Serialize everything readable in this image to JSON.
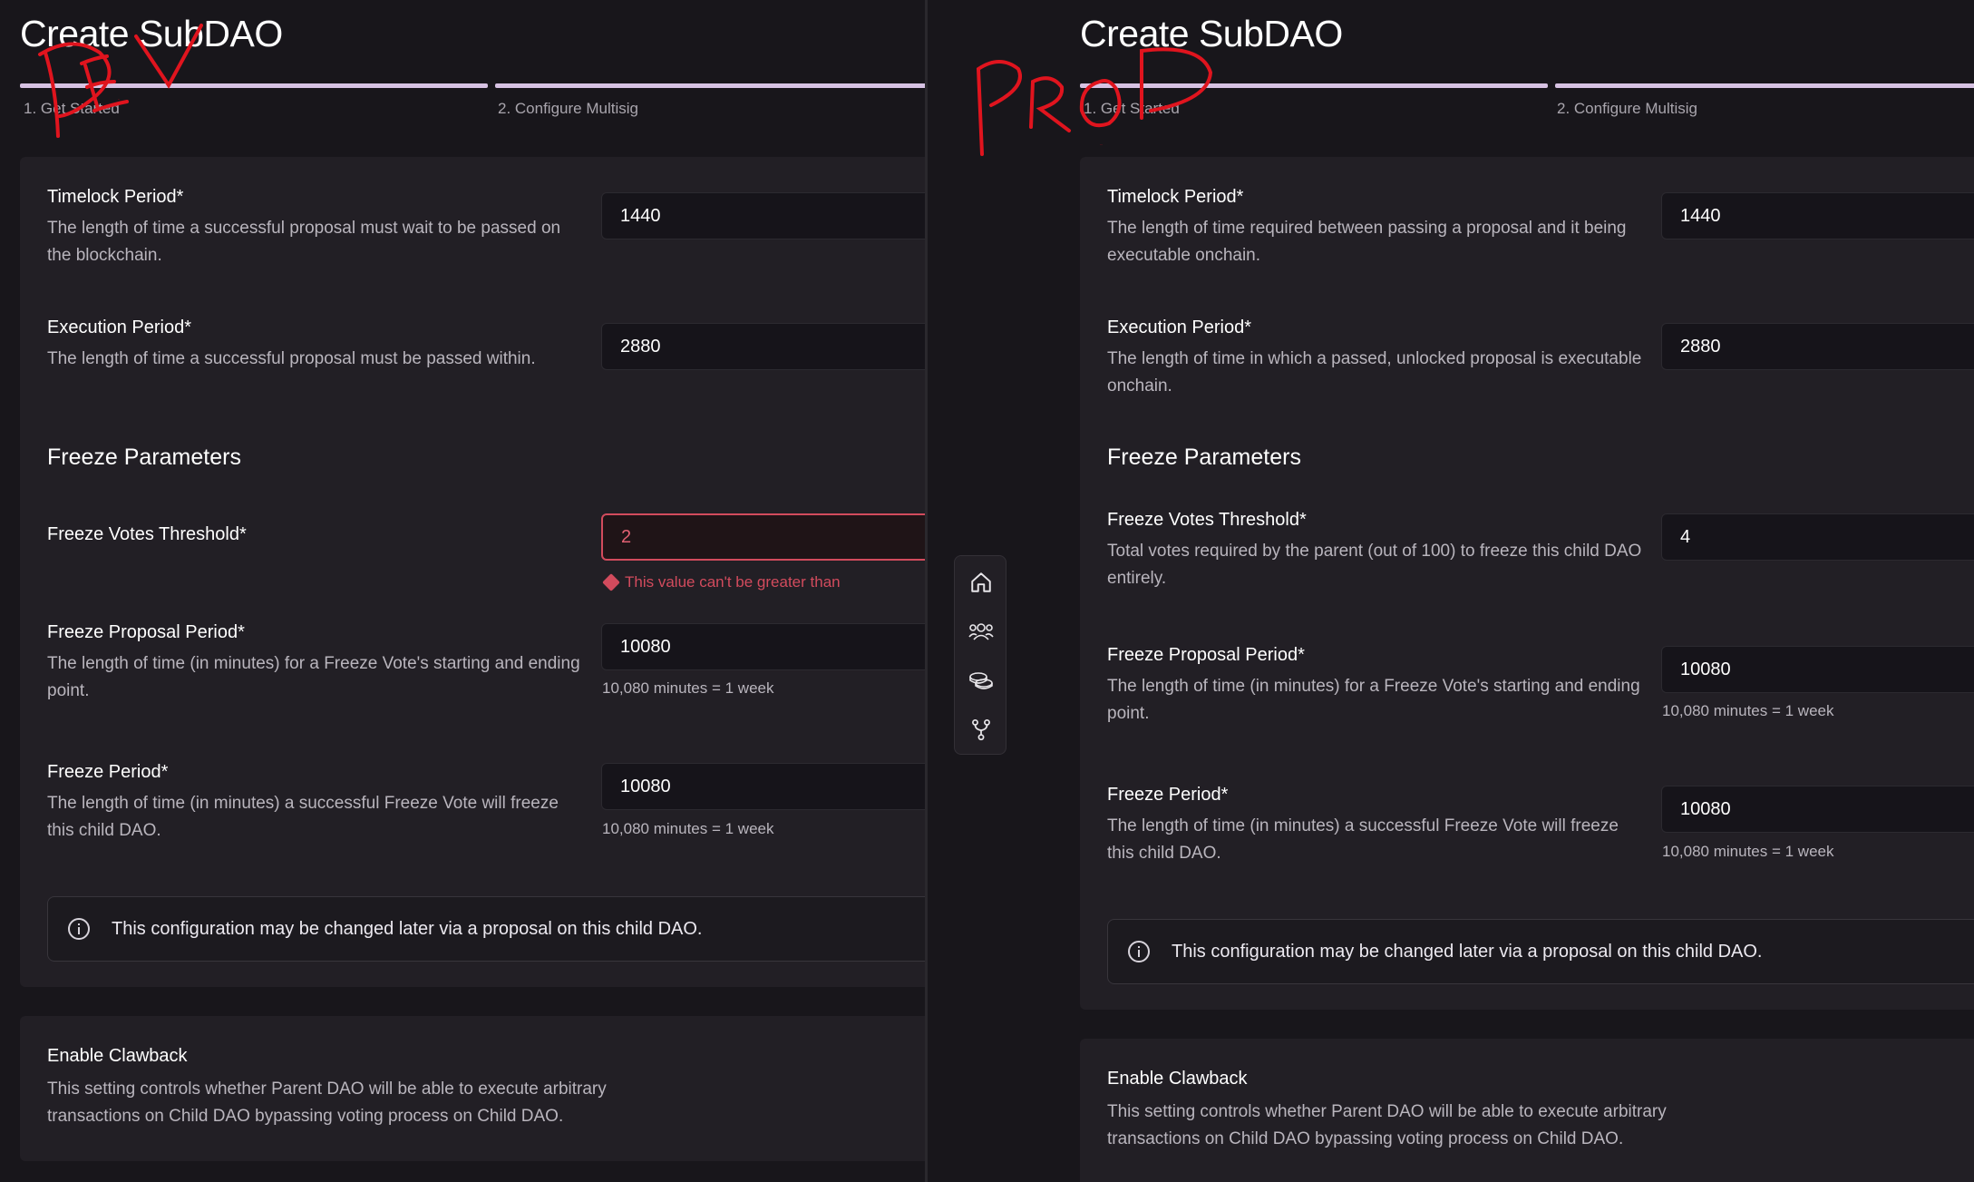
{
  "dev": {
    "annotation": "DEV",
    "title": "Create SubDAO",
    "steps": [
      "1. Get Started",
      "2. Configure Multisig"
    ],
    "timelock": {
      "label": "Timelock Period*",
      "desc": "The length of time a successful proposal must wait to be passed on the blockchain.",
      "value": "1440"
    },
    "execution": {
      "label": "Execution Period*",
      "desc": "The length of time a successful proposal must be passed within.",
      "value": "2880"
    },
    "freeze_title": "Freeze Parameters",
    "freeze_votes": {
      "label": "Freeze Votes Threshold*",
      "value": "2",
      "error": "This value can't be greater than"
    },
    "freeze_proposal": {
      "label": "Freeze Proposal Period*",
      "desc": "The length of time (in minutes) for a Freeze Vote's starting and ending point.",
      "value": "10080",
      "helper": "10,080 minutes = 1 week"
    },
    "freeze_period": {
      "label": "Freeze Period*",
      "desc": "The length of time (in minutes) a successful Freeze Vote will freeze this child DAO.",
      "value": "10080",
      "helper": "10,080 minutes = 1 week"
    },
    "info": "This configuration may be changed later via a proposal on this child DAO.",
    "clawback": {
      "label": "Enable Clawback",
      "desc": "This setting controls whether Parent DAO will be able to execute arbitrary transactions on Child DAO bypassing voting process on Child DAO."
    }
  },
  "prod": {
    "annotation": "PROD",
    "title": "Create SubDAO",
    "steps": [
      "1. Get Started",
      "2. Configure Multisig"
    ],
    "timelock": {
      "label": "Timelock Period*",
      "desc": "The length of time required between passing a proposal and it being executable onchain.",
      "value": "1440"
    },
    "execution": {
      "label": "Execution Period*",
      "desc": "The length of time in which a passed, unlocked proposal is executable onchain.",
      "value": "2880"
    },
    "freeze_title": "Freeze Parameters",
    "freeze_votes": {
      "label": "Freeze Votes Threshold*",
      "desc": "Total votes required by the parent (out of 100) to freeze this child DAO entirely.",
      "value": "4"
    },
    "freeze_proposal": {
      "label": "Freeze Proposal Period*",
      "desc": "The length of time (in minutes) for a Freeze Vote's starting and ending point.",
      "value": "10080",
      "helper": "10,080 minutes = 1 week"
    },
    "freeze_period": {
      "label": "Freeze Period*",
      "desc": "The length of time (in minutes) a successful Freeze Vote will freeze this child DAO.",
      "value": "10080",
      "helper": "10,080 minutes = 1 week"
    },
    "info": "This configuration may be changed later via a proposal on this child DAO.",
    "clawback": {
      "label": "Enable Clawback",
      "desc": "This setting controls whether Parent DAO will be able to execute arbitrary transactions on Child DAO bypassing voting process on Child DAO."
    }
  },
  "sidebar": {
    "icons": [
      "home-icon",
      "people-icon",
      "coins-icon",
      "fork-icon"
    ]
  },
  "colors": {
    "background": "#18161b",
    "card": "#221f25",
    "accent_bar": "#d7c2e3",
    "error": "#d24b5d",
    "annotation": "#e0141e"
  }
}
